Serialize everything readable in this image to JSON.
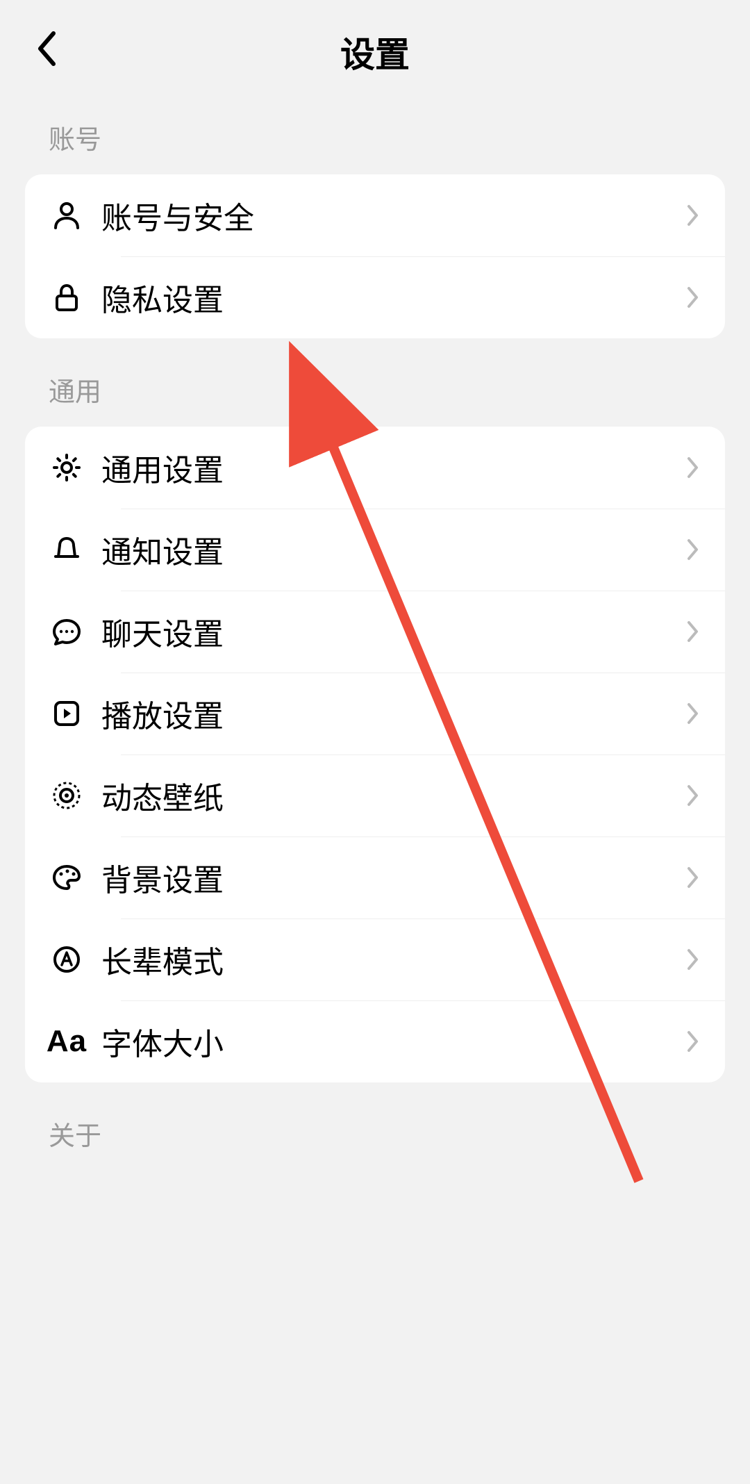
{
  "header": {
    "title": "设置"
  },
  "sections": {
    "account": {
      "title": "账号",
      "items": [
        {
          "label": "账号与安全",
          "icon": "person"
        },
        {
          "label": "隐私设置",
          "icon": "lock"
        }
      ]
    },
    "general": {
      "title": "通用",
      "items": [
        {
          "label": "通用设置",
          "icon": "gear"
        },
        {
          "label": "通知设置",
          "icon": "bell"
        },
        {
          "label": "聊天设置",
          "icon": "chat"
        },
        {
          "label": "播放设置",
          "icon": "play"
        },
        {
          "label": "动态壁纸",
          "icon": "target"
        },
        {
          "label": "背景设置",
          "icon": "palette"
        },
        {
          "label": "长辈模式",
          "icon": "circle-a"
        },
        {
          "label": "字体大小",
          "icon": "aa"
        }
      ]
    },
    "about": {
      "title": "关于"
    }
  },
  "annotation": {
    "color": "#ee4b3a"
  }
}
